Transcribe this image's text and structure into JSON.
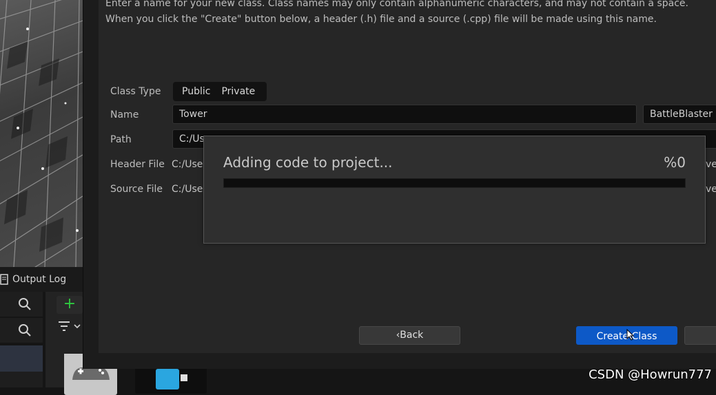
{
  "dialog": {
    "description_line1": "Enter a name for your new class. Class names may only contain alphanumeric characters, and may not contain a space.",
    "description_line2": "When you click the \"Create\" button below, a header (.h) file and a source (.cpp) file will be made using this name.",
    "labels": {
      "class_type": "Class Type",
      "name": "Name",
      "path": "Path",
      "header_file": "Header File",
      "source_file": "Source File"
    },
    "class_type_options": [
      "Public",
      "Private"
    ],
    "name_value": "Tower",
    "module_value": "BattleBlaster (",
    "path_value": "C:/Us",
    "header_file_value": "C:/Use",
    "source_file_value": "C:/Use",
    "header_file_trunc": "ver",
    "source_file_trunc": "ver",
    "back_label": "Back",
    "create_label": "Create Class"
  },
  "progress": {
    "title": "Adding code to project...",
    "percent_label": "%0",
    "value": 0
  },
  "editor": {
    "output_log_label": "Output Log"
  },
  "watermark": "CSDN @Howrun777",
  "colors": {
    "accent": "#0d59c7",
    "progress_fill": "#0070e0",
    "add_green": "#2ecc40"
  }
}
